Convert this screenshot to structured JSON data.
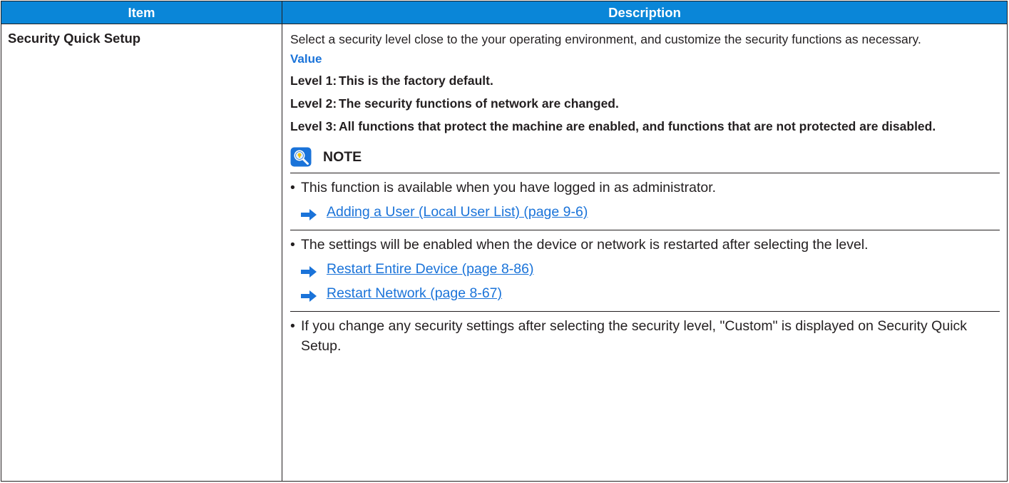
{
  "table": {
    "headers": {
      "item": "Item",
      "description": "Description"
    },
    "row": {
      "item": "Security Quick Setup",
      "intro": "Select a security level close to the your operating environment, and customize the security functions as necessary.",
      "value_heading": "Value",
      "levels": [
        {
          "key": "Level 1:",
          "text": "This is the factory default."
        },
        {
          "key": "Level 2:",
          "text": "The security functions of network are changed."
        },
        {
          "key": "Level 3:",
          "text": "All functions that protect the machine are enabled, and functions that are not protected are disabled."
        }
      ],
      "note": {
        "title": "NOTE",
        "icon": "lightbulb-magnifier-icon",
        "bullets": [
          {
            "text": "This function is available when you have logged in as administrator.",
            "refs": [
              "Adding a User (Local User List) (page 9-6)"
            ]
          },
          {
            "text": "The settings will be enabled when the device or network is restarted after selecting the level.",
            "refs": [
              "Restart Entire Device (page 8-86)",
              "Restart Network (page 8-67)"
            ]
          },
          {
            "text": "If you change any security settings after selecting the security level, \"Custom\" is displayed on Security Quick Setup.",
            "refs": []
          }
        ]
      }
    }
  },
  "colors": {
    "header_bg": "#0a86d8",
    "link": "#1a73d9",
    "value_heading": "#1a73d9",
    "arrow": "#1a73d9",
    "text": "#231f20"
  }
}
